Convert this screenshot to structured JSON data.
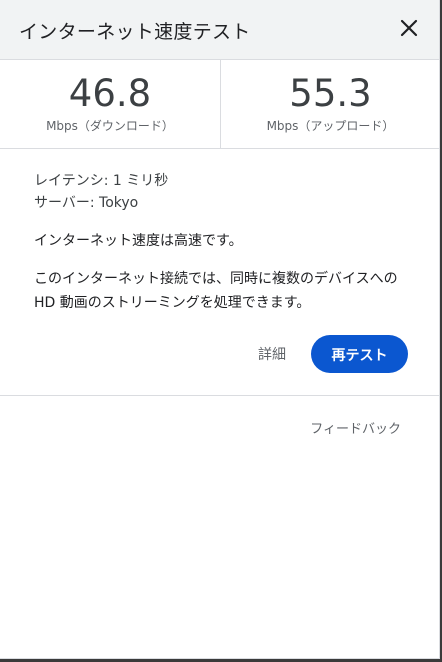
{
  "header": {
    "title": "インターネット速度テスト",
    "close_icon": "close-icon"
  },
  "metrics": {
    "download": {
      "value": "46.8",
      "unit": "Mbps（ダウンロード）"
    },
    "upload": {
      "value": "55.3",
      "unit": "Mbps（アップロード）"
    }
  },
  "info": {
    "latency": "レイテンシ: 1 ミリ秒",
    "server": "サーバー: Tokyo"
  },
  "status": "インターネット速度は高速です。",
  "description": "このインターネット接続では、同時に複数のデバイスへの HD 動画のストリーミングを処理できます。",
  "actions": {
    "details_label": "詳細",
    "retest_label": "再テスト"
  },
  "feedback_label": "フィードバック",
  "colors": {
    "accent": "#0b57d0",
    "header_bg": "#f1f3f4",
    "divider": "#dadce0"
  }
}
